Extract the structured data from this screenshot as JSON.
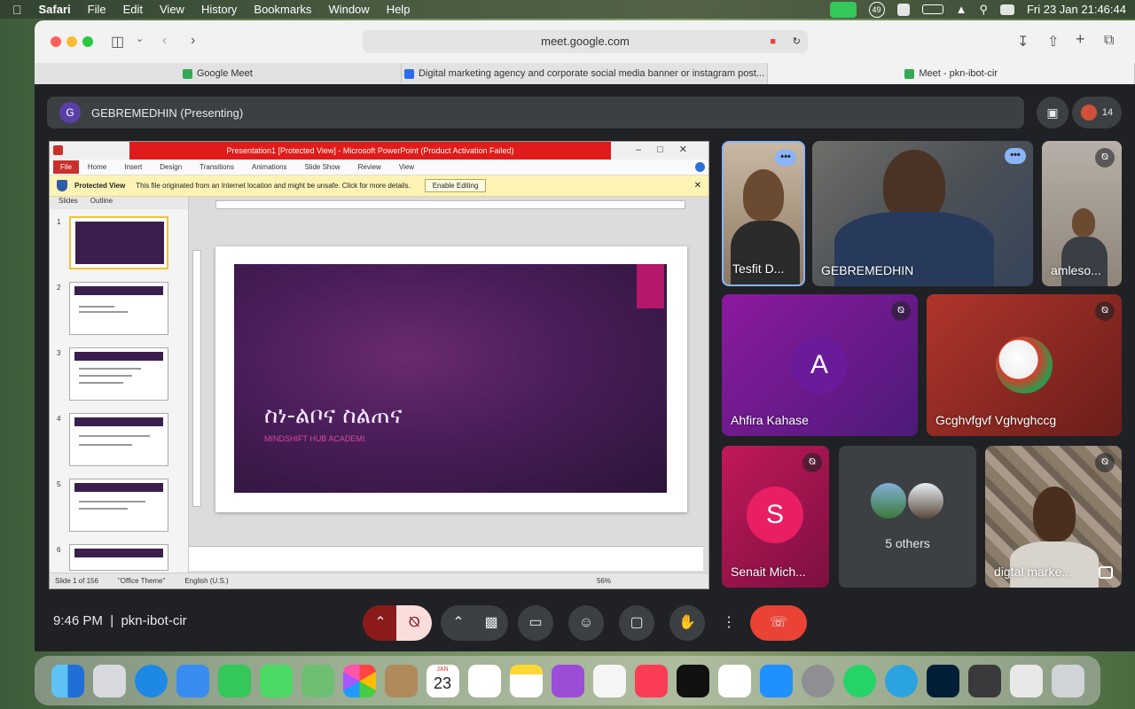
{
  "menubar": {
    "apple": "",
    "items": [
      "Safari",
      "File",
      "Edit",
      "View",
      "History",
      "Bookmarks",
      "Window",
      "Help"
    ],
    "datetime": "Fri 23 Jan  21:46:44",
    "badge": "49"
  },
  "browser": {
    "url": "meet.google.com",
    "tabs": [
      {
        "label": "Google Meet"
      },
      {
        "label": "Digital marketing agency and corporate social media banner or instagram post..."
      },
      {
        "label": "Meet - pkn-ibot-cir"
      }
    ]
  },
  "meet": {
    "presenter_initial": "G",
    "presenter_label": "GEBREMEDHIN (Presenting)",
    "participant_count": "14",
    "time": "9:46 PM",
    "meeting_code": "pkn-ibot-cir",
    "others_label": "5 others",
    "participants": [
      {
        "name": "Tesfit D..."
      },
      {
        "name": "GEBREMEDHIN"
      },
      {
        "name": "amleso..."
      },
      {
        "name": "Ahfira Kahase",
        "initial": "A"
      },
      {
        "name": "Gcghvfgvf Vghvghccg"
      },
      {
        "name": "Senait Mich...",
        "initial": "S"
      },
      {
        "name": "digtal marke..."
      }
    ]
  },
  "ppt": {
    "title": "Presentation1 [Protected View] - Microsoft PowerPoint (Product Activation Failed)",
    "file_tab": "File",
    "ribbon": [
      "Home",
      "Insert",
      "Design",
      "Transitions",
      "Animations",
      "Slide Show",
      "Review",
      "View"
    ],
    "protected_title": "Protected View",
    "protected_msg": "This file originated from an Internet location and might be unsafe. Click for more details.",
    "enable_btn": "Enable Editing",
    "panel_tabs": [
      "Slides",
      "Outline"
    ],
    "slide_numbers": [
      "1",
      "2",
      "3",
      "4",
      "5",
      "6"
    ],
    "slide_title": "ስነ-ልቦና ስልጠና",
    "slide_subtitle": "MINDSHIFT HUB ACADEMI",
    "status_slide": "Slide 1 of 156",
    "status_theme": "\"Office Theme\"",
    "status_lang": "English (U.S.)",
    "zoom": "56%"
  },
  "dock": {
    "calendar_month": "JAN",
    "calendar_day": "23"
  },
  "colors": {
    "meet_bg": "#202124",
    "end_call": "#ea4335",
    "mic_off": "#8b1a1a"
  }
}
